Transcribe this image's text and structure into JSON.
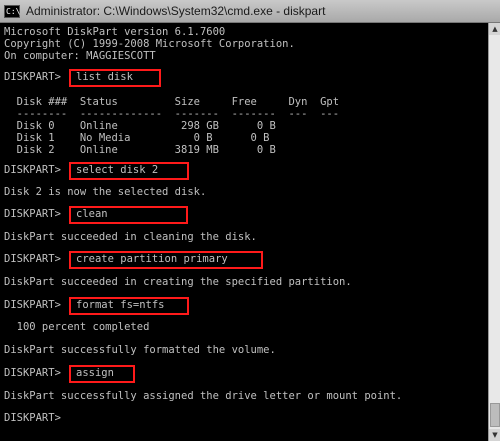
{
  "window": {
    "title": "Administrator: C:\\Windows\\System32\\cmd.exe - diskpart"
  },
  "console": {
    "banner": [
      "Microsoft DiskPart version 6.1.7600",
      "Copyright (C) 1999-2008 Microsoft Corporation.",
      "On computer: MAGGIESCOTT"
    ],
    "prompt": "DISKPART>",
    "commands": [
      "list disk",
      "select disk 2",
      "clean",
      "create partition primary",
      "format fs=ntfs",
      "assign"
    ],
    "disk_table": {
      "header": "  Disk ###  Status         Size     Free     Dyn  Gpt",
      "separator": "  --------  -------------  -------  -------  ---  ---",
      "rows": [
        "  Disk 0    Online          298 GB      0 B",
        "  Disk 1    No Media          0 B      0 B",
        "  Disk 2    Online         3819 MB      0 B"
      ]
    },
    "outputs": {
      "select": "Disk 2 is now the selected disk.",
      "clean": "DiskPart succeeded in cleaning the disk.",
      "create": "DiskPart succeeded in creating the specified partition.",
      "format_progress": "  100 percent completed",
      "format": "DiskPart successfully formatted the volume.",
      "assign": "DiskPart successfully assigned the drive letter or mount point."
    }
  },
  "colors": {
    "console_bg": "#000000",
    "console_text": "#c0c0c0",
    "highlight": "#ff1a1a"
  },
  "icons": {
    "window_icon": "cmd-icon"
  }
}
